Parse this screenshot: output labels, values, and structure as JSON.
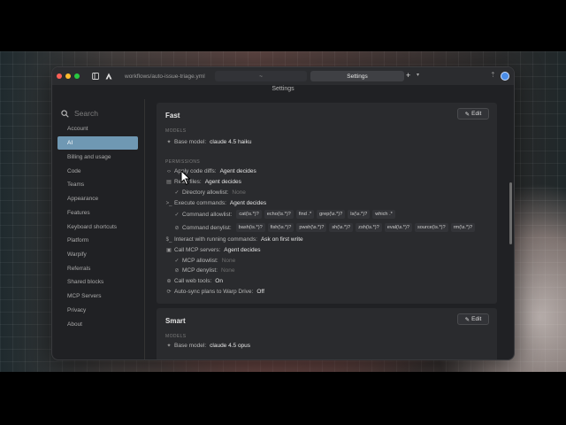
{
  "tabs": {
    "path": "workflows/auto-issue-triage.yml",
    "middle": "~",
    "active": "Settings"
  },
  "settings_title": "Settings",
  "sidebar": {
    "search_placeholder": "Search",
    "items": [
      {
        "label": "Account"
      },
      {
        "label": "AI",
        "active": true
      },
      {
        "label": "Billing and usage"
      },
      {
        "label": "Code"
      },
      {
        "label": "Teams"
      },
      {
        "label": "Appearance"
      },
      {
        "label": "Features"
      },
      {
        "label": "Keyboard shortcuts"
      },
      {
        "label": "Platform"
      },
      {
        "label": "Warpify"
      },
      {
        "label": "Referrals"
      },
      {
        "label": "Shared blocks"
      },
      {
        "label": "MCP Servers"
      },
      {
        "label": "Privacy"
      },
      {
        "label": "About"
      }
    ]
  },
  "fast": {
    "title": "Fast",
    "edit_label": "Edit",
    "models_header": "MODELS",
    "base_model_label": "Base model:",
    "base_model_value": "claude 4.5 haiku",
    "permissions_header": "PERMISSIONS",
    "apply_diffs_label": "Apply code diffs:",
    "apply_diffs_value": "Agent decides",
    "read_files_label": "Read files:",
    "read_files_value": "Agent decides",
    "dir_allowlist_label": "Directory allowlist:",
    "dir_allowlist_value": "None",
    "exec_label": "Execute commands:",
    "exec_value": "Agent decides",
    "cmd_allowlist_label": "Command allowlist:",
    "cmd_allowlist": [
      "cat(\\s.*)?",
      "echo(\\s.*)?",
      "find .*",
      "grep(\\s.*)?",
      "ls(\\s.*)?",
      "which .*"
    ],
    "cmd_denylist_label": "Command denylist:",
    "cmd_denylist": [
      "bash(\\s.*)?",
      "fish(\\s.*)?",
      "pwsh(\\s.*)?",
      "sh(\\s.*)?",
      "zsh(\\s.*)?",
      "eval(\\s.*)?",
      "source(\\s.*)?",
      "rm(\\s.*)?"
    ],
    "interact_label": "Interact with running commands:",
    "interact_value": "Ask on first write",
    "mcp_label": "Call MCP servers:",
    "mcp_value": "Agent decides",
    "mcp_allowlist_label": "MCP allowlist:",
    "mcp_allowlist_value": "None",
    "mcp_denylist_label": "MCP denylist:",
    "mcp_denylist_value": "None",
    "web_label": "Call web tools:",
    "web_value": "On",
    "autosync_label": "Auto-sync plans to Warp Drive:",
    "autosync_value": "Off"
  },
  "smart": {
    "title": "Smart",
    "edit_label": "Edit",
    "models_header": "MODELS",
    "base_model_label": "Base model:",
    "base_model_value": "claude 4.5 opus"
  },
  "icons": {
    "search": "search-icon",
    "edit": "pencil-icon",
    "sidebar_toggle": "sidebar-toggle-icon",
    "app": "warp-logo-icon"
  }
}
